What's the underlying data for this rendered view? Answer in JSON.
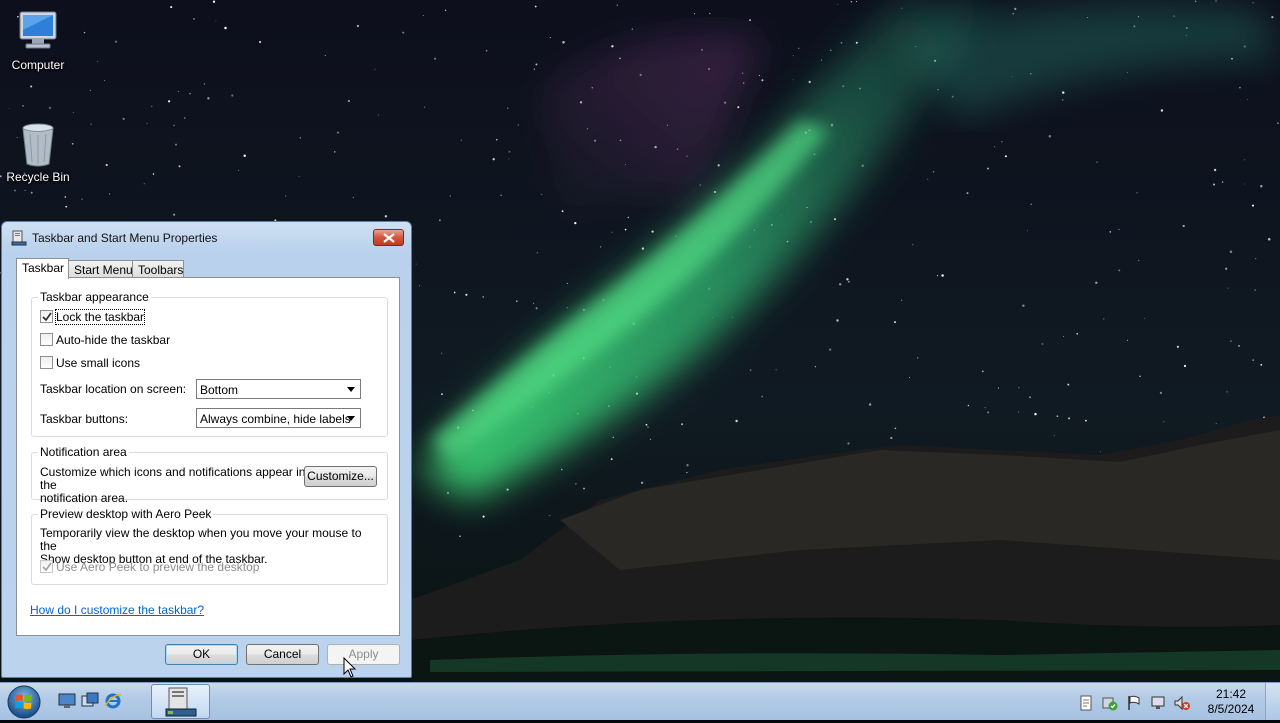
{
  "desktop": {
    "icons": [
      {
        "label": "Computer",
        "icon": "computer-icon"
      },
      {
        "label": "Recycle Bin",
        "icon": "recycle-bin-icon"
      }
    ]
  },
  "dialog": {
    "title": "Taskbar and Start Menu Properties",
    "tabs": [
      {
        "label": "Taskbar",
        "active": true
      },
      {
        "label": "Start Menu",
        "active": false
      },
      {
        "label": "Toolbars",
        "active": false
      }
    ],
    "appearance": {
      "group_label": "Taskbar appearance",
      "lock_label": "Lock the taskbar",
      "lock_checked": true,
      "autohide_label": "Auto-hide the taskbar",
      "autohide_checked": false,
      "small_icons_label": "Use small icons",
      "small_icons_checked": false,
      "location_label": "Taskbar location on screen:",
      "location_value": "Bottom",
      "buttons_label": "Taskbar buttons:",
      "buttons_value": "Always combine, hide labels"
    },
    "notification": {
      "group_label": "Notification area",
      "description_line1": "Customize which icons and notifications appear in the",
      "description_line2": "notification area.",
      "customize_button": "Customize..."
    },
    "aero_peek": {
      "group_label": "Preview desktop with Aero Peek",
      "description_line1": "Temporarily view the desktop when you move your mouse to the",
      "description_line2": "Show desktop button at end of the taskbar.",
      "checkbox_label": "Use Aero Peek to preview the desktop",
      "checkbox_checked": true,
      "checkbox_disabled": true
    },
    "help_link": "How do I customize the taskbar?",
    "buttons": {
      "ok": "OK",
      "cancel": "Cancel",
      "apply": "Apply"
    }
  },
  "taskbar": {
    "clock_time": "21:42",
    "clock_date": "8/5/2024"
  },
  "colors": {
    "link": "#0066cc",
    "aurora_green": "#3fe07a",
    "close_red": "#c03a22"
  }
}
